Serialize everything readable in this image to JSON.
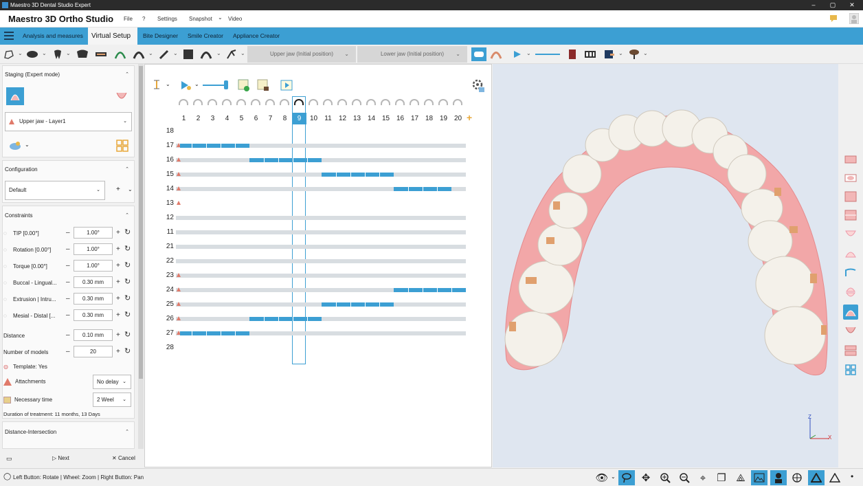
{
  "window": {
    "title": "Maestro 3D Dental Studio Expert",
    "min": "–",
    "max": "▢",
    "close": "✕"
  },
  "menubar": {
    "app_title": "Maestro 3D Ortho Studio",
    "items": [
      "File",
      "?",
      "Settings",
      "Snapshot",
      "Video"
    ],
    "snapshot_arrow": "⌄"
  },
  "tabs": [
    "Analysis and measures",
    "Virtual Setup",
    "Bite Designer",
    "Smile Creator",
    "Appliance Creator"
  ],
  "toolbar": {
    "upper_jaw": "Upper jaw (Initial position)",
    "lower_jaw": "Lower jaw (Initial position)"
  },
  "staging": {
    "title": "Staging (Expert mode)",
    "layer": "Upper jaw - Layer1"
  },
  "configuration": {
    "title": "Configuration",
    "value": "Default"
  },
  "constraints": {
    "title": "Constraints",
    "rows": [
      {
        "label": "TIP [0.00°]",
        "value": "1.00°"
      },
      {
        "label": "Rotation [0.00°]",
        "value": "1.00°"
      },
      {
        "label": "Torque [0.00°]",
        "value": "1.00°"
      },
      {
        "label": "Buccal - Lingual...",
        "value": "0.30 mm"
      },
      {
        "label": "Extrusion | Intru...",
        "value": "0.30 mm"
      },
      {
        "label": "Mesial - Distal [...",
        "value": "0.30 mm"
      }
    ],
    "distance_label": "Distance",
    "distance_value": "0.10 mm",
    "models_label": "Number of models",
    "models_value": "20",
    "template": "Template: Yes",
    "attachments_label": "Attachments",
    "attachments_value": "No delay",
    "necessary_label": "Necessary time",
    "necessary_value": "2 Weel",
    "duration": "Duration of treatment: 11 months, 13 Days"
  },
  "distance_intersection": {
    "title": "Distance-Intersection"
  },
  "footer": {
    "next": "Next",
    "cancel": "Cancel"
  },
  "staging_grid": {
    "steps": [
      "1",
      "2",
      "3",
      "4",
      "5",
      "6",
      "7",
      "8",
      "9",
      "10",
      "11",
      "12",
      "13",
      "14",
      "15",
      "16",
      "17",
      "18",
      "19",
      "20"
    ],
    "selected_step": 9,
    "add": "+",
    "rows": [
      {
        "tooth": "18",
        "track": false,
        "attach": false,
        "from": null,
        "to": null
      },
      {
        "tooth": "17",
        "track": true,
        "attach": true,
        "from": 1,
        "to": 5
      },
      {
        "tooth": "16",
        "track": true,
        "attach": true,
        "from": 6,
        "to": 10
      },
      {
        "tooth": "15",
        "track": true,
        "attach": true,
        "from": 11,
        "to": 15
      },
      {
        "tooth": "14",
        "track": true,
        "attach": true,
        "from": 16,
        "to": 19
      },
      {
        "tooth": "13",
        "track": false,
        "attach": true,
        "from": null,
        "to": null
      },
      {
        "tooth": "12",
        "track": true,
        "attach": false,
        "from": null,
        "to": null
      },
      {
        "tooth": "11",
        "track": true,
        "attach": false,
        "from": null,
        "to": null
      },
      {
        "tooth": "21",
        "track": true,
        "attach": false,
        "from": null,
        "to": null
      },
      {
        "tooth": "22",
        "track": true,
        "attach": false,
        "from": null,
        "to": null
      },
      {
        "tooth": "23",
        "track": true,
        "attach": true,
        "from": null,
        "to": null
      },
      {
        "tooth": "24",
        "track": true,
        "attach": true,
        "from": 16,
        "to": 20
      },
      {
        "tooth": "25",
        "track": true,
        "attach": true,
        "from": 11,
        "to": 15
      },
      {
        "tooth": "26",
        "track": true,
        "attach": true,
        "from": 6,
        "to": 10
      },
      {
        "tooth": "27",
        "track": true,
        "attach": true,
        "from": 1,
        "to": 5
      },
      {
        "tooth": "28",
        "track": false,
        "attach": false,
        "from": null,
        "to": null
      }
    ]
  },
  "status": {
    "text": "Left Button: Rotate | Wheel: Zoom | Right Button: Pan"
  },
  "axes": {
    "z": "Z",
    "x": "X"
  },
  "colors": {
    "accent": "#3c9fd3",
    "gum": "#f2a7a8",
    "tooth": "#f4f1ea",
    "attachment": "#e0a06e"
  }
}
